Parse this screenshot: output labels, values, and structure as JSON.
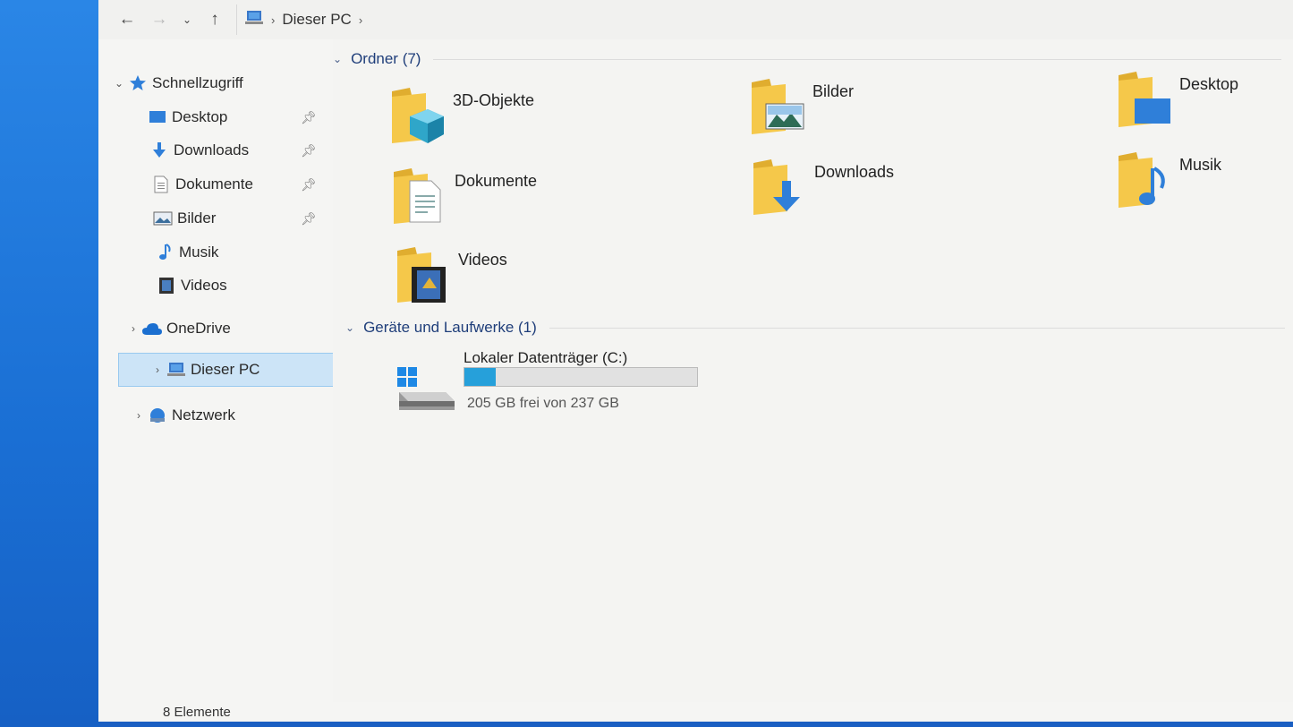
{
  "address": {
    "back_icon": "arrow-left-icon",
    "forward_icon": "arrow-right-icon",
    "recent_icon": "chevron-down-icon",
    "up_icon": "arrow-up-icon",
    "location": "Dieser PC",
    "separator": "›"
  },
  "sidebar": {
    "quick_access": "Schnellzugriff",
    "quick_items": [
      {
        "label": "Desktop",
        "icon": "desktop-icon",
        "pinned": true
      },
      {
        "label": "Downloads",
        "icon": "download-icon",
        "pinned": true
      },
      {
        "label": "Dokumente",
        "icon": "document-icon",
        "pinned": true
      },
      {
        "label": "Bilder",
        "icon": "pictures-icon",
        "pinned": true
      },
      {
        "label": "Musik",
        "icon": "music-icon",
        "pinned": false
      },
      {
        "label": "Videos",
        "icon": "video-icon",
        "pinned": false
      }
    ],
    "onedrive": "OneDrive",
    "this_pc": "Dieser PC",
    "network": "Netzwerk"
  },
  "content": {
    "folders_header": "Ordner (7)",
    "folders": [
      {
        "label": "3D-Objekte",
        "overlay": "cube-icon"
      },
      {
        "label": "Bilder",
        "overlay": "landscape-icon"
      },
      {
        "label": "Desktop",
        "overlay": "desktop-icon"
      },
      {
        "label": "Dokumente",
        "overlay": "document-icon"
      },
      {
        "label": "Downloads",
        "overlay": "download-icon"
      },
      {
        "label": "Musik",
        "overlay": "music-icon"
      },
      {
        "label": "Videos",
        "overlay": "film-icon"
      }
    ],
    "devices_header": "Geräte und Laufwerke (1)",
    "drive": {
      "name": "Lokaler Datenträger (C:)",
      "free_text": "205 GB frei von 237 GB",
      "used_fraction": 0.135
    }
  },
  "status": {
    "items": "8 Elemente"
  },
  "colors": {
    "accent": "#26a0da",
    "folder_yellow": "#f5c84a",
    "selection": "#cce4f7",
    "header_text": "#1f3e7a",
    "desktop_blue": "#1c6fd6"
  }
}
